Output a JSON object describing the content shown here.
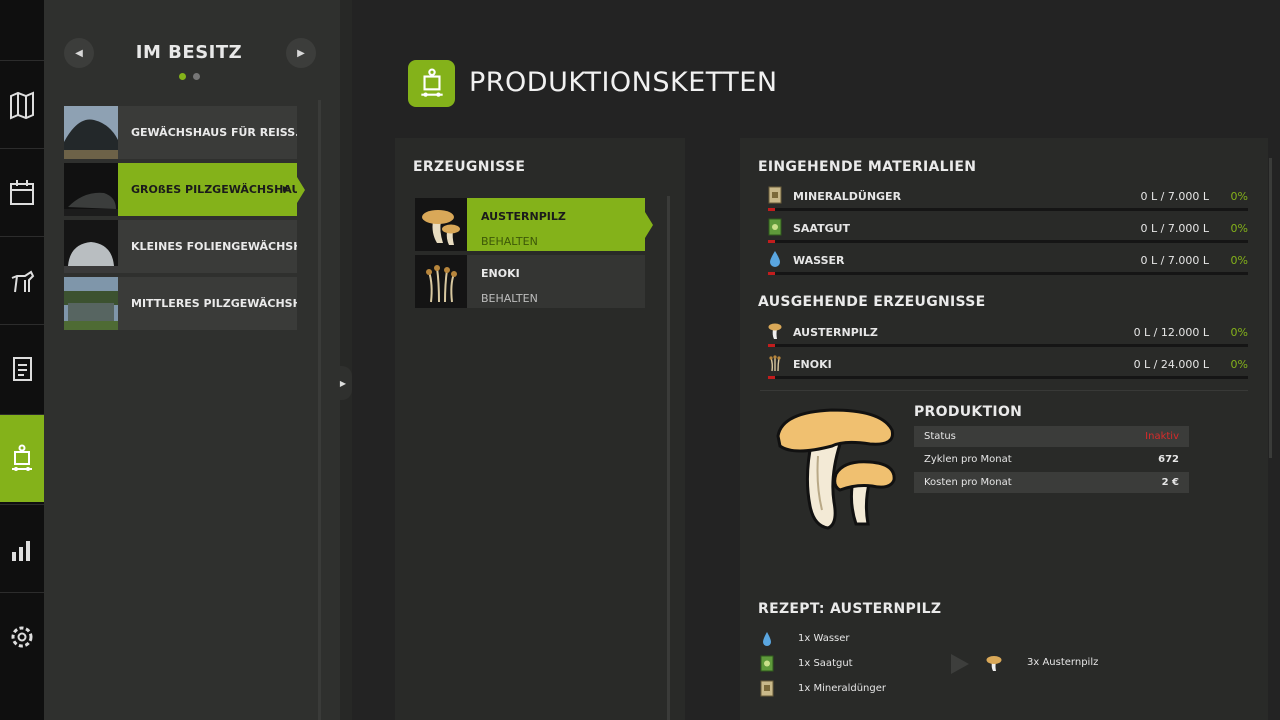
{
  "rail": {
    "items": [
      {
        "icon": "map-icon"
      },
      {
        "icon": "calendar-icon"
      },
      {
        "icon": "animals-icon"
      },
      {
        "icon": "contracts-icon"
      },
      {
        "icon": "production-icon",
        "active": true
      },
      {
        "icon": "statistics-icon"
      },
      {
        "icon": "settings-icon"
      }
    ]
  },
  "owned": {
    "title": "IM BESITZ",
    "items": [
      {
        "label": "GEWÄCHSHAUS FÜR REISS..."
      },
      {
        "label": "GROßES PILZGEWÄCHSHAUS",
        "active": true
      },
      {
        "label": "KLEINES FOLIENGEWÄCHSH..."
      },
      {
        "label": "MITTLERES PILZGEWÄCHSH..."
      }
    ]
  },
  "header": {
    "title": "PRODUKTIONSKETTEN"
  },
  "products": {
    "title": "ERZEUGNISSE",
    "items": [
      {
        "name": "AUSTERNPILZ",
        "status": "BEHALTEN",
        "active": true
      },
      {
        "name": "ENOKI",
        "status": "BEHALTEN"
      }
    ]
  },
  "incoming": {
    "title": "EINGEHENDE MATERIALIEN",
    "items": [
      {
        "name": "MINERALDÜNGER",
        "amount": "0 L / 7.000 L",
        "percent": "0%",
        "fill": 0
      },
      {
        "name": "SAATGUT",
        "amount": "0 L / 7.000 L",
        "percent": "0%",
        "fill": 0
      },
      {
        "name": "WASSER",
        "amount": "0 L / 7.000 L",
        "percent": "0%",
        "fill": 0
      }
    ]
  },
  "outgoing": {
    "title": "AUSGEHENDE ERZEUGNISSE",
    "items": [
      {
        "name": "AUSTERNPILZ",
        "amount": "0 L / 12.000 L",
        "percent": "0%",
        "fill": 0
      },
      {
        "name": "ENOKI",
        "amount": "0 L / 24.000 L",
        "percent": "0%",
        "fill": 0
      }
    ]
  },
  "production": {
    "title": "PRODUKTION",
    "rows": [
      {
        "label": "Status",
        "value": "Inaktiv"
      },
      {
        "label": "Zyklen pro Monat",
        "value": "672"
      },
      {
        "label": "Kosten pro Monat",
        "value": "2 €"
      }
    ]
  },
  "recipe": {
    "title": "REZEPT: AUSTERNPILZ",
    "inputs": [
      "1x Wasser",
      "1x Saatgut",
      "1x Mineraldünger"
    ],
    "output": "3x Austernpilz"
  },
  "colors": {
    "accent": "#84b21a",
    "alert": "#d72b2b"
  }
}
